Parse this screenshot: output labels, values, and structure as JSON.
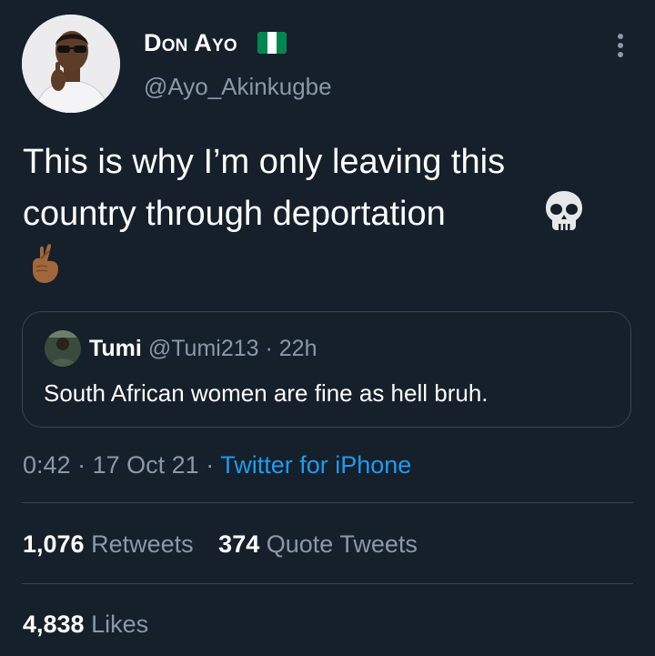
{
  "author": {
    "display_name": "Don Ayo",
    "handle": "@Ayo_Akinkugbe",
    "flag_icon": "nigeria-flag-icon",
    "flag_colors": [
      "#008751",
      "#ffffff",
      "#008751"
    ]
  },
  "menu": {
    "icon": "more-vertical-icon"
  },
  "tweet": {
    "text": "This is why I’m only leaving this\ncountry through deportation",
    "emojis": [
      "skull-icon",
      "crossed-fingers-icon"
    ]
  },
  "quoted_tweet": {
    "name": "Tumi",
    "handle": "@Tumi213",
    "separator": "·",
    "time": "22h",
    "text": "South African women are fine as hell bruh."
  },
  "meta": {
    "time": "0:42",
    "separator": "·",
    "date": "17 Oct 21",
    "source": "Twitter for iPhone"
  },
  "stats": {
    "retweets_count": "1,076",
    "retweets_label": "Retweets",
    "quote_count": "374",
    "quote_label": "Quote Tweets",
    "likes_count": "4,838",
    "likes_label": "Likes"
  },
  "colors": {
    "background": "#15202b",
    "text_primary": "#ffffff",
    "text_secondary": "#8b98a5",
    "link": "#1d9bf0",
    "border": "#38444d"
  }
}
